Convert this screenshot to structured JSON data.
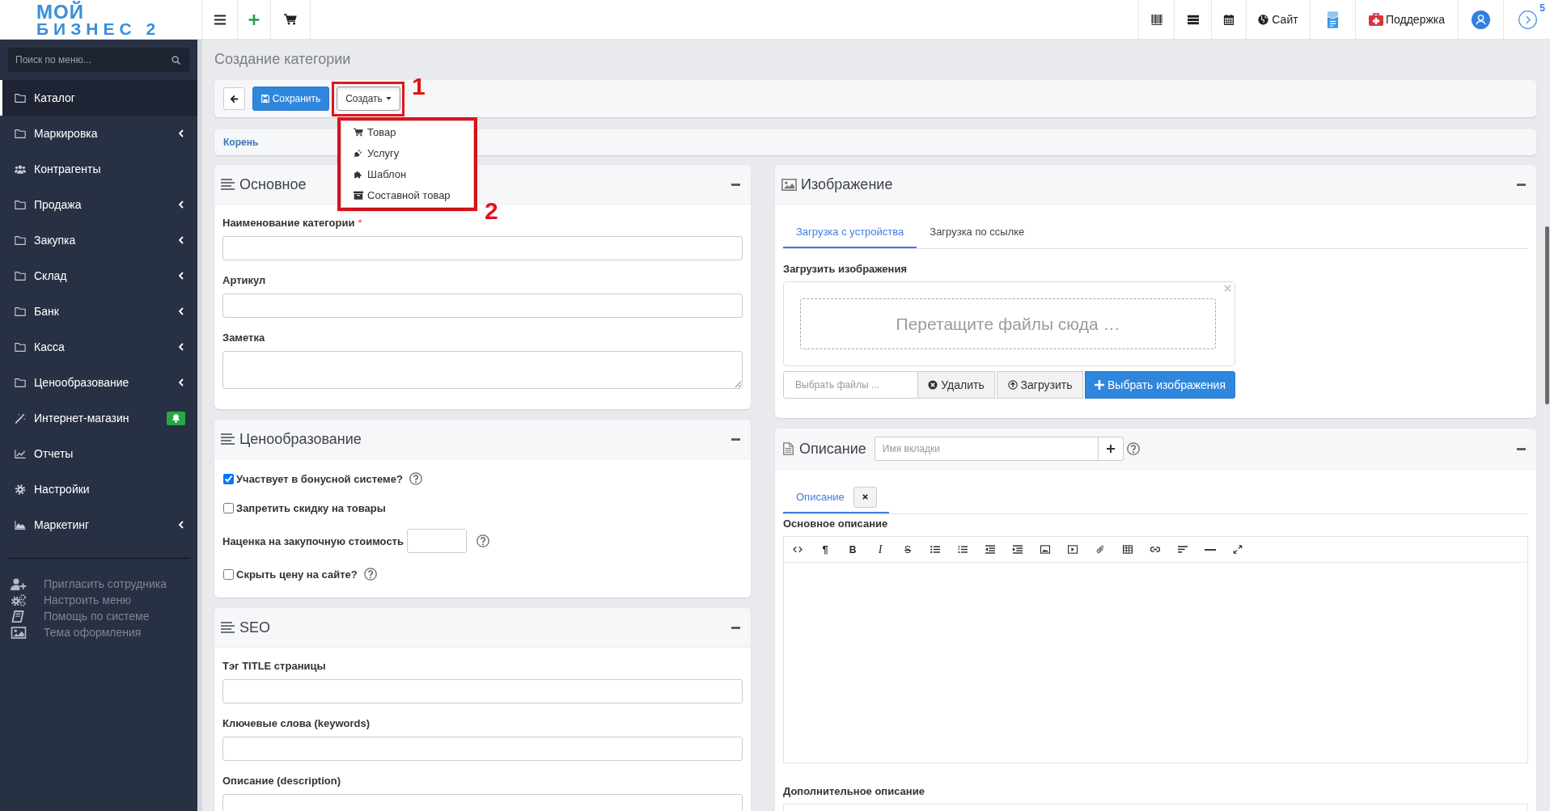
{
  "header": {
    "logo": {
      "top": "МОЙ",
      "bottom": "БИЗНЕС 2"
    },
    "site_link": "Сайт",
    "support_link": "Поддержка",
    "notification_count": "5"
  },
  "sidebar": {
    "search": {
      "placeholder": "Поиск по меню..."
    },
    "items": [
      {
        "kind": "folder",
        "label": "Каталог",
        "selected": true,
        "has_submenu": false,
        "alert": false
      },
      {
        "kind": "folder",
        "label": "Маркировка",
        "selected": false,
        "has_submenu": true,
        "alert": false
      },
      {
        "kind": "users",
        "label": "Контрагенты",
        "selected": false,
        "has_submenu": false,
        "alert": false
      },
      {
        "kind": "folder",
        "label": "Продажа",
        "selected": false,
        "has_submenu": true,
        "alert": false
      },
      {
        "kind": "folder",
        "label": "Закупка",
        "selected": false,
        "has_submenu": true,
        "alert": false
      },
      {
        "kind": "folder",
        "label": "Склад",
        "selected": false,
        "has_submenu": true,
        "alert": false
      },
      {
        "kind": "folder",
        "label": "Банк",
        "selected": false,
        "has_submenu": true,
        "alert": false
      },
      {
        "kind": "folder",
        "label": "Касса",
        "selected": false,
        "has_submenu": true,
        "alert": false
      },
      {
        "kind": "folder",
        "label": "Ценообразование",
        "selected": false,
        "has_submenu": true,
        "alert": false
      },
      {
        "kind": "wand",
        "label": "Интернет-магазин",
        "selected": false,
        "has_submenu": false,
        "alert": true
      },
      {
        "kind": "chart",
        "label": "Отчеты",
        "selected": false,
        "has_submenu": false,
        "alert": false
      },
      {
        "kind": "gear",
        "label": "Настройки",
        "selected": false,
        "has_submenu": false,
        "alert": false
      },
      {
        "kind": "area",
        "label": "Маркетинг",
        "selected": false,
        "has_submenu": true,
        "alert": false
      }
    ],
    "footer_links": [
      {
        "kind": "invite",
        "label": "Пригласить сотрудника"
      },
      {
        "kind": "cogs",
        "label": "Настроить меню"
      },
      {
        "kind": "book",
        "label": "Помощь по системе"
      },
      {
        "kind": "picture",
        "label": "Тема оформления"
      }
    ]
  },
  "page": {
    "title": "Создание категории",
    "toolbar": {
      "save_label": "Сохранить",
      "create_button": {
        "label": "Создать",
        "expanded": true,
        "annotation": "1"
      },
      "create_menu": {
        "annotation": "2",
        "items": [
          {
            "kind": "cart",
            "label": "Товар"
          },
          {
            "kind": "plug",
            "label": "Услугу"
          },
          {
            "kind": "puzzle",
            "label": "Шаблон"
          },
          {
            "kind": "box",
            "label": "Составной товар"
          }
        ]
      }
    },
    "breadcrumb": [
      "Корень"
    ],
    "main_panel": {
      "title": "Основное",
      "fields": [
        {
          "kind": "input",
          "label": "Наименование категории",
          "required_mark": "*"
        },
        {
          "kind": "input",
          "label": "Артикул"
        },
        {
          "kind": "textarea",
          "label": "Заметка"
        }
      ]
    },
    "pricing_panel": {
      "title": "Ценообразование",
      "options": [
        {
          "kind": "checkbox",
          "label": "Участвует в бонусной системе?",
          "checked": true,
          "help": true
        },
        {
          "kind": "checkbox",
          "label": "Запретить скидку на товары",
          "checked": false,
          "help": false
        },
        {
          "kind": "number",
          "label": "Наценка на закупочную стоимость",
          "help": true
        },
        {
          "kind": "checkbox",
          "label": "Скрыть цену на сайте?",
          "checked": false,
          "help": true
        }
      ]
    },
    "seo_panel": {
      "title": "SEO",
      "fields": [
        {
          "label": "Тэг TITLE страницы"
        },
        {
          "label": "Ключевые слова (keywords)"
        },
        {
          "label": "Описание (description)"
        }
      ]
    },
    "image_panel": {
      "title": "Изображение",
      "tabs": [
        {
          "label": "Загрузка с устройства",
          "selected": true
        },
        {
          "label": "Загрузка по ссылке",
          "selected": false
        }
      ],
      "upload_label": "Загрузить изображения",
      "drop_hint": "Перетащите файлы сюда …",
      "file_field": {
        "placeholder": "Выбрать файлы ..."
      },
      "buttons": [
        {
          "kind": "remove",
          "label": "Удалить"
        },
        {
          "kind": "upload",
          "label": "Загрузить"
        },
        {
          "kind": "browse",
          "label": "Выбрать изображения"
        }
      ]
    },
    "description_panel": {
      "title": "Описание",
      "tab_name_field": {
        "placeholder": "Имя вкладки"
      },
      "tabs": [
        {
          "label": "Описание",
          "selected": true
        }
      ],
      "main_editor": {
        "label": "Основное описание",
        "tools": [
          {
            "kind": "code"
          },
          {
            "kind": "paragraph",
            "glyph": "¶"
          },
          {
            "kind": "bold",
            "glyph": "B"
          },
          {
            "kind": "italic",
            "glyph": "I"
          },
          {
            "kind": "strike",
            "glyph": "S"
          },
          {
            "kind": "bullets"
          },
          {
            "kind": "numbers"
          },
          {
            "kind": "outdent"
          },
          {
            "kind": "indent"
          },
          {
            "kind": "image"
          },
          {
            "kind": "video"
          },
          {
            "kind": "attach"
          },
          {
            "kind": "table"
          },
          {
            "kind": "link"
          },
          {
            "kind": "align"
          },
          {
            "kind": "rule"
          },
          {
            "kind": "fullscreen"
          }
        ]
      },
      "extra_editor": {
        "label": "Дополнительное описание"
      }
    }
  }
}
